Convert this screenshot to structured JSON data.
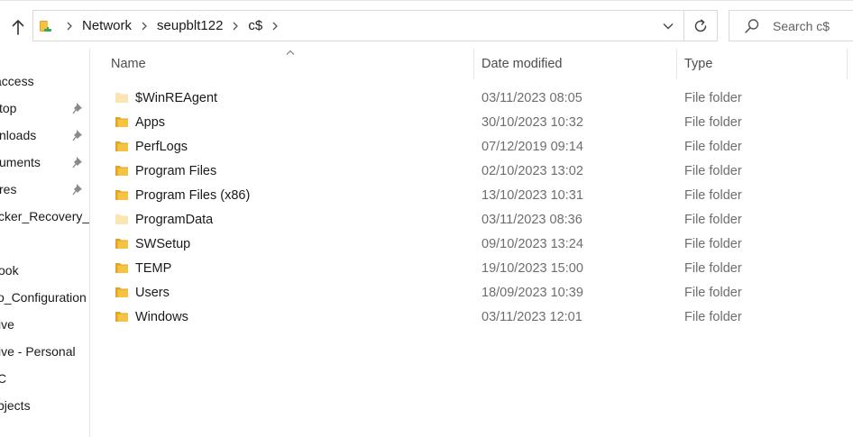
{
  "address_bar": {
    "crumbs": [
      "Network",
      "seupblt122",
      "c$"
    ]
  },
  "search": {
    "placeholder": "Search c$"
  },
  "nav": {
    "items": [
      {
        "label": "access",
        "pinned": false
      },
      {
        "label": "top",
        "pinned": true
      },
      {
        "label": "nloads",
        "pinned": true
      },
      {
        "label": "uments",
        "pinned": true
      },
      {
        "label": "res",
        "pinned": true
      },
      {
        "label": "cker_Recovery_",
        "pinned": false
      },
      {
        "label": "",
        "pinned": false
      },
      {
        "label": "ook",
        "pinned": false
      },
      {
        "label": "o_Configuration",
        "pinned": false
      },
      {
        "label": "ive",
        "pinned": false
      },
      {
        "label": "ive - Personal",
        "pinned": false
      },
      {
        "label": "C",
        "pinned": false
      },
      {
        "label": "bjects",
        "pinned": false
      }
    ]
  },
  "columns": {
    "name": "Name",
    "date": "Date modified",
    "type": "Type"
  },
  "files": [
    {
      "name": "$WinREAgent",
      "date": "03/11/2023 08:05",
      "type": "File folder",
      "hidden": true
    },
    {
      "name": "Apps",
      "date": "30/10/2023 10:32",
      "type": "File folder",
      "hidden": false
    },
    {
      "name": "PerfLogs",
      "date": "07/12/2019 09:14",
      "type": "File folder",
      "hidden": false
    },
    {
      "name": "Program Files",
      "date": "02/10/2023 13:02",
      "type": "File folder",
      "hidden": false
    },
    {
      "name": "Program Files (x86)",
      "date": "13/10/2023 10:31",
      "type": "File folder",
      "hidden": false
    },
    {
      "name": "ProgramData",
      "date": "03/11/2023 08:36",
      "type": "File folder",
      "hidden": true
    },
    {
      "name": "SWSetup",
      "date": "09/10/2023 13:24",
      "type": "File folder",
      "hidden": false
    },
    {
      "name": "TEMP",
      "date": "19/10/2023 15:00",
      "type": "File folder",
      "hidden": false
    },
    {
      "name": "Users",
      "date": "18/09/2023 10:39",
      "type": "File folder",
      "hidden": false
    },
    {
      "name": "Windows",
      "date": "03/11/2023 12:01",
      "type": "File folder",
      "hidden": false
    }
  ],
  "colors": {
    "folder": "#F5C242",
    "folder_back": "#E0A526",
    "folder_hidden": "#F9E6B3"
  }
}
